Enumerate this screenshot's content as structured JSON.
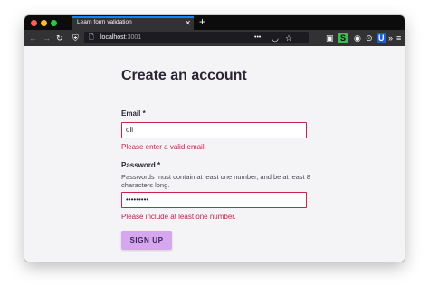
{
  "browser": {
    "tab_title": "Learn form validation",
    "tab_close": "✕",
    "new_tab": "+",
    "url_host": "localhost",
    "url_port": ":3001",
    "nav": {
      "back_icon": "←",
      "forward_icon": "→",
      "reload_icon": "↻",
      "shield_icon": "⛨",
      "page_info_icon": "🗋",
      "more_icon": "•••",
      "pocket_icon": "◡",
      "bookmark_icon": "☆",
      "ext1_icon": "▣",
      "ext2_icon": "S",
      "ext3_icon": "◉",
      "ext4_icon": "⊙",
      "ext5_icon": "U",
      "overflow_icon": "»",
      "menu_icon": "≡"
    }
  },
  "form": {
    "title": "Create an account",
    "email": {
      "label": "Email *",
      "value": "oli",
      "error": "Please enter a valid email."
    },
    "password": {
      "label": "Password *",
      "hint": "Passwords must contain at least one number, and be at least 8 characters long.",
      "value": "•••••••••",
      "error": "Please include at least one number."
    },
    "submit_label": "SIGN UP"
  },
  "colors": {
    "error": "#c0214a",
    "button": "#d6a6ee",
    "accent": "#0a84ff"
  }
}
